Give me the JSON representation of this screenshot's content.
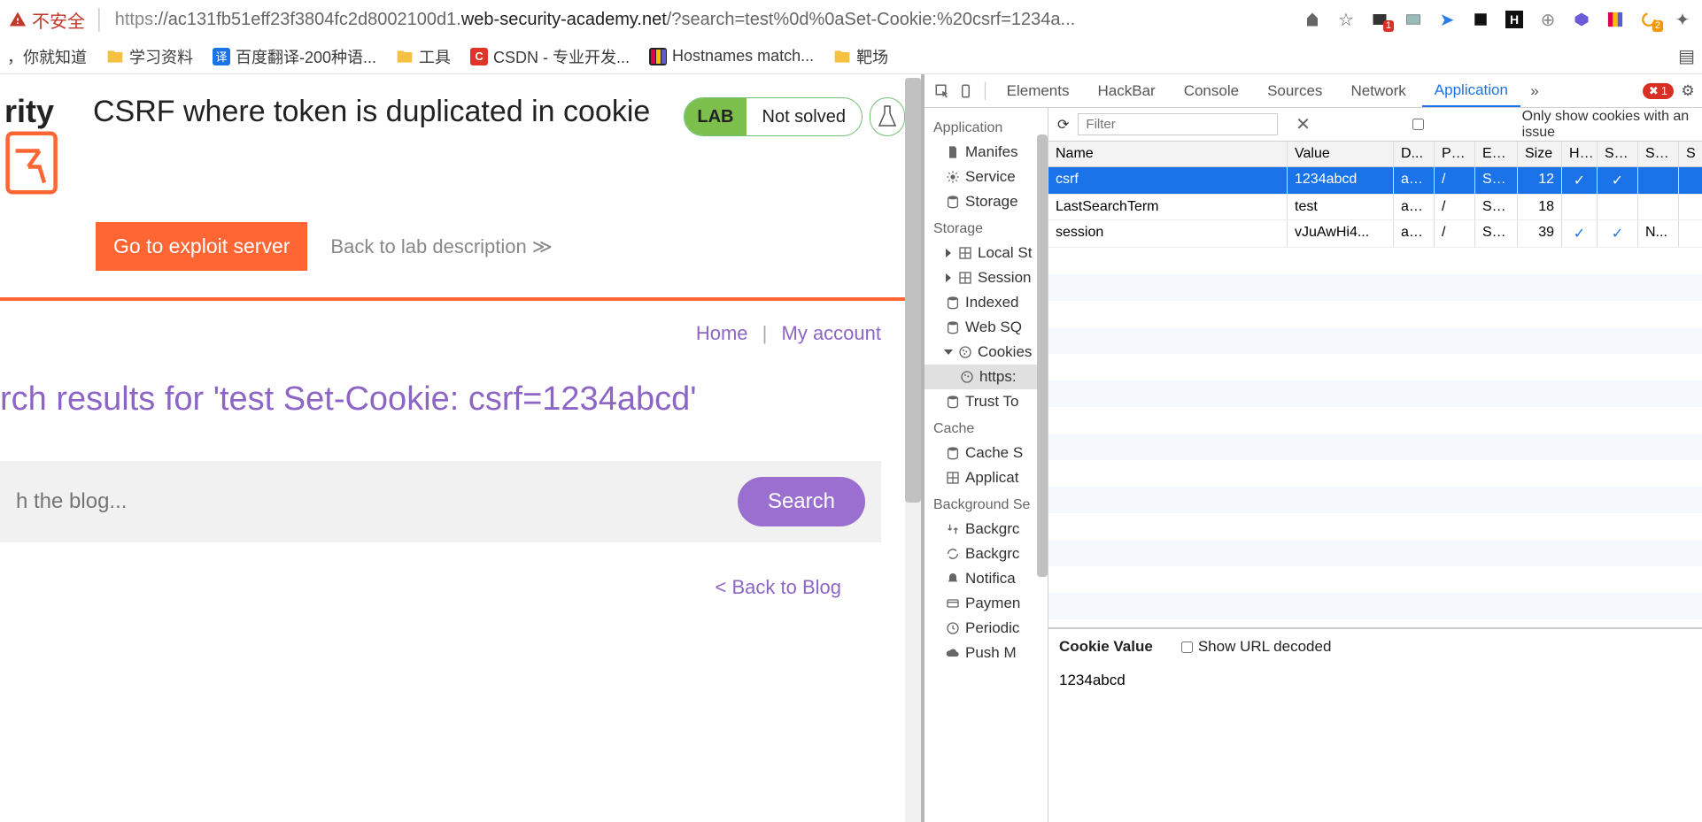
{
  "addrbar": {
    "insecure": "不安全",
    "url_prefix": "https",
    "url_host": "://ac131fb51eff23f3804fc2d8002100d1.",
    "url_domain": "web-security-academy.net",
    "url_path": "/?search=test%0d%0aSet-Cookie:%20csrf=1234a...",
    "ext_badge1": "1",
    "ext_badge2": "2"
  },
  "bookmarks": {
    "b0": "，你就知道",
    "b1": "学习资料",
    "b2": "百度翻译-200种语...",
    "b3": "工具",
    "b4": "CSDN - 专业开发...",
    "b5": "Hostnames match...",
    "b6": "靶场"
  },
  "lab": {
    "title": "CSRF where token is duplicated in cookie",
    "badge": "LAB",
    "status": "Not solved",
    "exploit": "Go to exploit server",
    "backdesc": "Back to lab description",
    "home": "Home",
    "account": "My account",
    "results": "rch results for 'test Set-Cookie: csrf=1234abcd'",
    "placeholder": "h the blog...",
    "search": "Search",
    "backblog": "< Back to Blog"
  },
  "devtabs": {
    "elements": "Elements",
    "hackbar": "HackBar",
    "console": "Console",
    "sources": "Sources",
    "network": "Network",
    "application": "Application",
    "errcount": "1"
  },
  "sidebar": {
    "application": "Application",
    "manifest": "Manifes",
    "sw": "Service",
    "storage": "Storage",
    "grp_storage": "Storage",
    "ls": "Local St",
    "ss": "Session",
    "idb": "Indexed",
    "wsql": "Web SQ",
    "cookies": "Cookies",
    "cookie_host": "https:",
    "trust": "Trust To",
    "grp_cache": "Cache",
    "cs": "Cache S",
    "ac": "Applicat",
    "grp_bg": "Background Se",
    "bf": "Backgrc",
    "bs": "Backgrc",
    "nt": "Notifica",
    "ph": "Paymen",
    "pb": "Periodic",
    "pm": "Push M"
  },
  "toolbar": {
    "filter": "Filter",
    "only_issues": "Only show cookies with an issue"
  },
  "cookie_headers": {
    "name": "Name",
    "value": "Value",
    "domain": "D...",
    "path": "Pa...",
    "expires": "Ex...",
    "size": "Size",
    "http": "H...",
    "secure": "Se...",
    "same": "Sa...",
    "s": "S"
  },
  "cookies": [
    {
      "name": "csrf",
      "value": "1234abcd",
      "domain": "ac...",
      "path": "/",
      "expires": "Se...",
      "size": "12",
      "http": "✓",
      "secure": "✓",
      "same": "",
      "s": ""
    },
    {
      "name": "LastSearchTerm",
      "value": "test",
      "domain": "ac...",
      "path": "/",
      "expires": "Se...",
      "size": "18",
      "http": "",
      "secure": "",
      "same": "",
      "s": ""
    },
    {
      "name": "session",
      "value": "vJuAwHi4...",
      "domain": "ac...",
      "path": "/",
      "expires": "Se...",
      "size": "39",
      "http": "✓",
      "secure": "✓",
      "same": "N...",
      "s": ""
    }
  ],
  "cookie_value": {
    "label": "Cookie Value",
    "decoded": "Show URL decoded",
    "val": "1234abcd"
  }
}
